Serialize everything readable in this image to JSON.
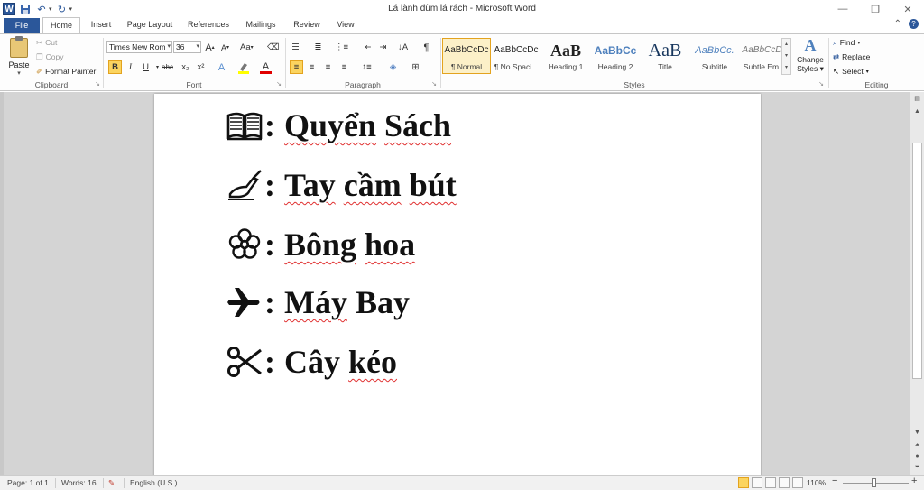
{
  "window": {
    "title": "Lá lành đùm lá rách - Microsoft Word"
  },
  "tabs": [
    "File",
    "Home",
    "Insert",
    "Page Layout",
    "References",
    "Mailings",
    "Review",
    "View"
  ],
  "ribbon": {
    "clipboard": {
      "label": "Clipboard",
      "paste": "Paste",
      "cut": "Cut",
      "copy": "Copy",
      "format_painter": "Format Painter"
    },
    "font": {
      "label": "Font",
      "font_name": "Times New Rom",
      "font_size": "36",
      "grow": "A",
      "shrink": "A",
      "case": "Aa",
      "bold": "B",
      "italic": "I",
      "underline": "U",
      "strike": "abc",
      "sub": "x₂",
      "sup": "x²",
      "font_color": "A",
      "highlight_color": "#ffff00",
      "font_color_value": "#e00000"
    },
    "paragraph": {
      "label": "Paragraph",
      "pilcrow": "¶"
    },
    "styles": {
      "label": "Styles",
      "items": [
        {
          "preview": "AaBbCcDc",
          "name": "¶ Normal"
        },
        {
          "preview": "AaBbCcDc",
          "name": "¶ No Spaci..."
        },
        {
          "preview": "AaB",
          "name": "Heading 1"
        },
        {
          "preview": "AaBbCc",
          "name": "Heading 2"
        },
        {
          "preview": "AaB",
          "name": "Title"
        },
        {
          "preview": "AaBbCc.",
          "name": "Subtitle"
        },
        {
          "preview": "AaBbCcDc",
          "name": "Subtle Em..."
        }
      ],
      "change_styles": "Change",
      "change_styles2": "Styles"
    },
    "editing": {
      "label": "Editing",
      "find": "Find",
      "replace": "Replace",
      "select": "Select"
    }
  },
  "document": {
    "lines": [
      {
        "icon": "book-icon",
        "colon": ":",
        "words": [
          "Quyển",
          "Sách"
        ]
      },
      {
        "icon": "writing-hand-icon",
        "colon": ":",
        "words": [
          "Tay",
          "cầm",
          "bút"
        ]
      },
      {
        "icon": "flower-icon",
        "colon": ":",
        "words": [
          "Bông",
          "hoa"
        ]
      },
      {
        "icon": "airplane-icon",
        "colon": ":",
        "words": [
          "Máy",
          "Bay"
        ]
      },
      {
        "icon": "scissors-icon",
        "colon": ":",
        "words": [
          "Cây",
          "kéo"
        ]
      }
    ]
  },
  "status": {
    "page": "Page: 1 of 1",
    "words": "Words: 16",
    "language": "English (U.S.)",
    "zoom": "110%",
    "zoom_minus": "−",
    "zoom_plus": "+"
  }
}
